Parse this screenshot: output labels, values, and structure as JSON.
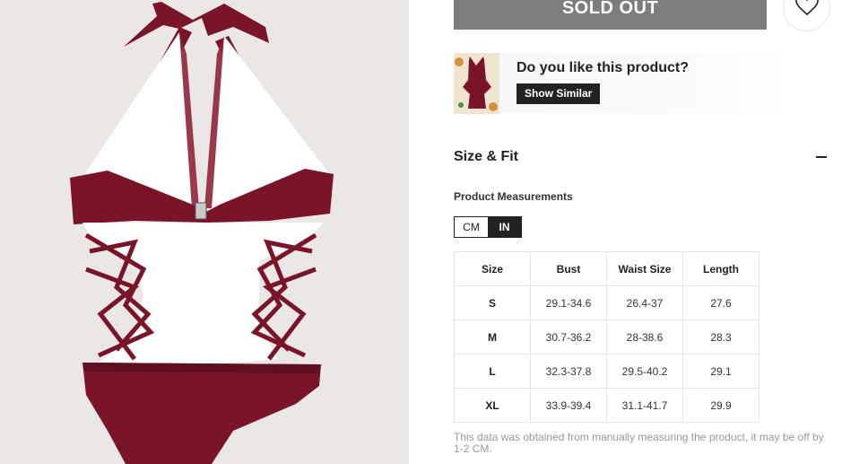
{
  "product": {
    "image_alt": "burgundy halter one-piece swimsuit back view",
    "main_color": "#7a1429",
    "lining_color": "#ffffff"
  },
  "purchase": {
    "sold_out_label": "SOLD OUT",
    "wishlist_icon": "heart-icon"
  },
  "similar": {
    "title": "Do you like this product?",
    "button_label": "Show Similar"
  },
  "size_fit": {
    "title": "Size & Fit",
    "toggle_icon": "minus-icon",
    "measurements_label": "Product Measurements",
    "units": [
      {
        "label": "CM",
        "active": false
      },
      {
        "label": "IN",
        "active": true
      }
    ],
    "table": {
      "headers": [
        "Size",
        "Bust",
        "Waist Size",
        "Length"
      ],
      "rows": [
        [
          "S",
          "29.1-34.6",
          "26.4-37",
          "27.6"
        ],
        [
          "M",
          "30.7-36.2",
          "28-38.6",
          "28.3"
        ],
        [
          "L",
          "32.3-37.8",
          "29.5-40.2",
          "29.1"
        ],
        [
          "XL",
          "33.9-39.4",
          "31.1-41.7",
          "29.9"
        ]
      ]
    },
    "disclaimer": "This data was obtained from manually measuring the product, it may be off by 1-2 CM."
  }
}
